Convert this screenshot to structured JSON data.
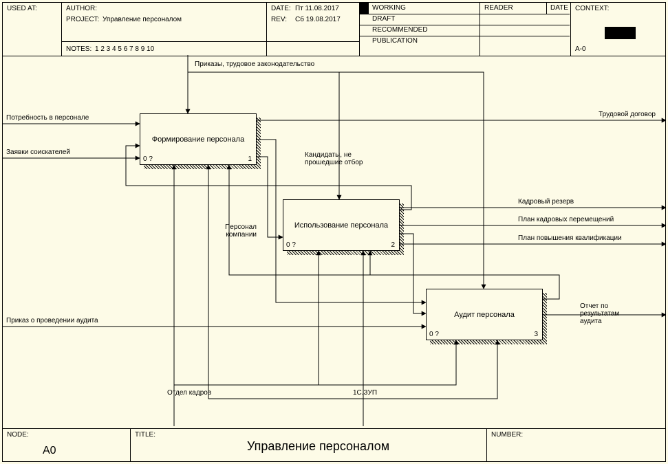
{
  "header": {
    "used_at_label": "USED AT:",
    "author_label": "AUTHOR:",
    "author": "",
    "project_label": "PROJECT:",
    "project": "Управление персоналом",
    "date_label": "DATE:",
    "date": "Пт 11.08.2017",
    "rev_label": "REV:",
    "rev": "Сб 19.08.2017",
    "notes_label": "NOTES:",
    "notes": "1  2  3  4  5  6  7  8  9  10",
    "status": {
      "working": "WORKING",
      "draft": "DRAFT",
      "recommended": "RECOMMENDED",
      "publication": "PUBLICATION"
    },
    "reader_label": "READER",
    "reader_date_label": "DATE",
    "context_label": "CONTEXT:",
    "context_value": "A-0"
  },
  "footer": {
    "node_label": "NODE:",
    "node": "A0",
    "title_label": "TITLE:",
    "title": "Управление персоналом",
    "number_label": "NUMBER:"
  },
  "activities": {
    "a1": {
      "name": "Формирование персонала",
      "left": "0 ?",
      "right": "1"
    },
    "a2": {
      "name": "Использование персонала",
      "left": "0 ?",
      "right": "2"
    },
    "a3": {
      "name": "Аудит персонала",
      "left": "0 ?",
      "right": "3"
    }
  },
  "arrows": {
    "control": "Приказы, трудовое законодательство",
    "in1": "Потребность в персонале",
    "in2": "Заявки соискателей",
    "in3": "Приказ о проведении аудита",
    "a1_out_top": "Трудовой договор",
    "a1_a2_feedback": "Кандидаты, не прошедшие отбор",
    "a1_a2_forward": "Персонал компании",
    "a2_out1": "Кадровый резерв",
    "a2_out2": "План кадровых перемещений",
    "a2_out3": "План повышения квалификации",
    "a3_out": "Отчет по результатам аудита",
    "mech1": "Отдел кадров",
    "mech2": "1С.ЗУП"
  }
}
